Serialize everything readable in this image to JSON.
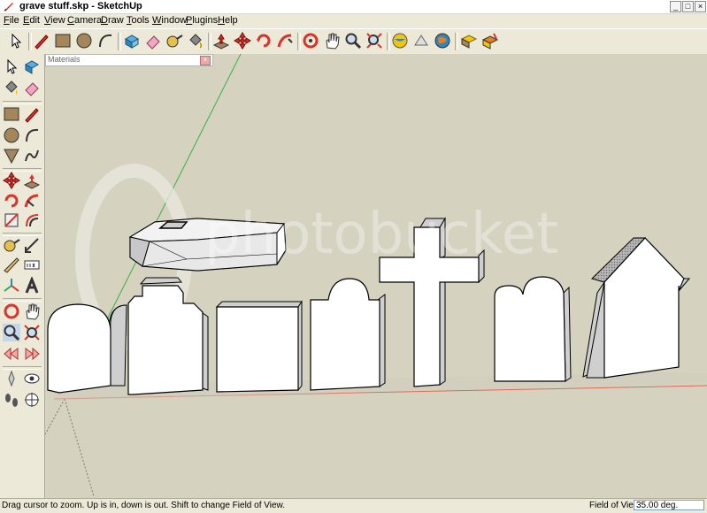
{
  "window": {
    "title": "grave stuff.skp - SketchUp",
    "minimize_label": "_",
    "maximize_label": "□",
    "close_label": "×"
  },
  "menu": [
    {
      "label": "File",
      "accel": "F",
      "rest": "ile"
    },
    {
      "label": "Edit",
      "accel": "E",
      "rest": "dit"
    },
    {
      "label": "View",
      "accel": "V",
      "rest": "iew"
    },
    {
      "label": "Camera",
      "accel": "C",
      "rest": "amera"
    },
    {
      "label": "Draw",
      "accel": "D",
      "rest": "raw"
    },
    {
      "label": "Tools",
      "accel": "T",
      "rest": "ools"
    },
    {
      "label": "Window",
      "accel": "W",
      "rest": "indow"
    },
    {
      "label": "Plugins",
      "accel": "P",
      "rest": "lugins"
    },
    {
      "label": "Help",
      "accel": "H",
      "rest": "elp"
    }
  ],
  "materials_panel": {
    "title": "Materials",
    "close_label": "×"
  },
  "status": {
    "message": "Drag cursor to zoom.  Up is in, down is out. Shift to change Field of View.",
    "fov_label": "Field of View",
    "fov_value": "35.00 deg."
  },
  "watermark": "photobucket",
  "colors": {
    "viewport_bg": "#d5d2c0",
    "chrome": "#ece9d8",
    "green_axis": "#3cb043",
    "red_axis": "#e06a55"
  }
}
